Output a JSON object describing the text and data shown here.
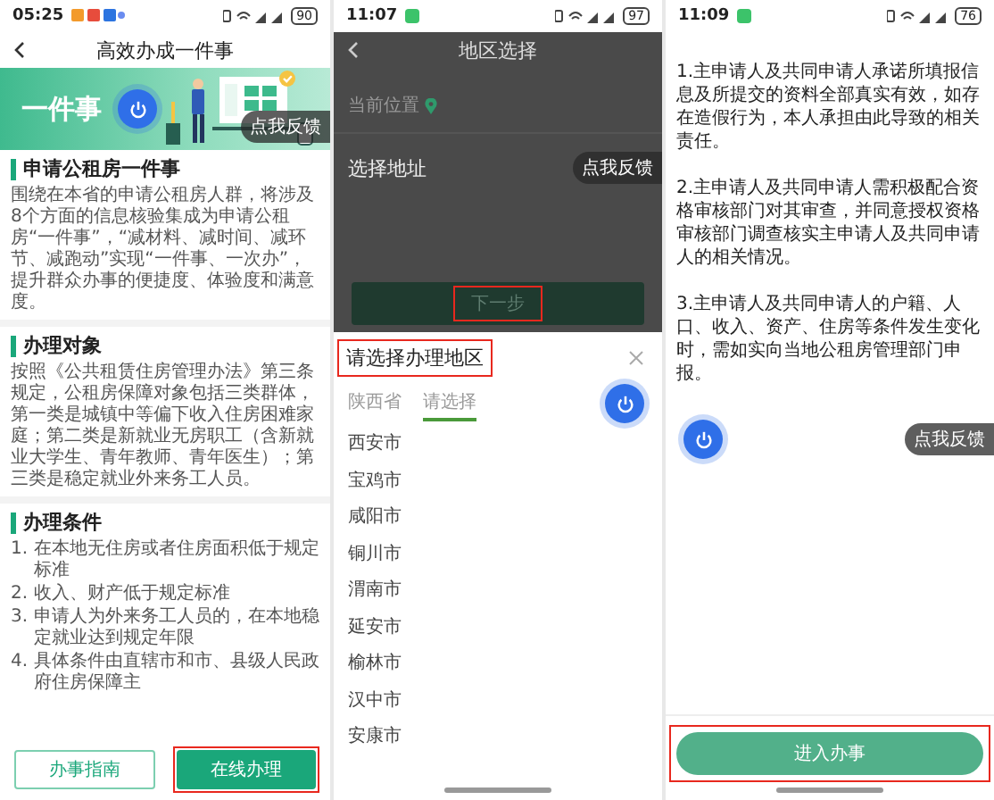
{
  "overview": {
    "status_bar": {
      "time": "05:25",
      "battery": "90"
    },
    "title": "高效办成一件事",
    "banner_text": "一件事",
    "feedback_label": "点我反馈",
    "sections": [
      {
        "heading": "申请公租房一件事",
        "kind": "paragraph",
        "text": "围绕在本省的申请公租房人群，将涉及8个方面的信息核验集成为申请公租房“一件事”，“减材料、减时间、减环节、减跑动”实现“一件事、一次办”，提升群众办事的便捷度、体验度和满意度。"
      },
      {
        "heading": "办理对象",
        "kind": "paragraph",
        "text": "按照《公共租赁住房管理办法》第三条规定，公租房保障对象包括三类群体，第一类是城镇中等偏下收入住房困难家庭；第二类是新就业无房职工（含新就业大学生、青年教师、青年医生）；第三类是稳定就业外来务工人员。"
      },
      {
        "heading": "办理条件",
        "kind": "list",
        "items": [
          {
            "number": "1.",
            "text": "在本地无住房或者住房面积低于规定标准"
          },
          {
            "number": "2.",
            "text": "收入、财产低于规定标准"
          },
          {
            "number": "3.",
            "text": "申请人为外来务工人员的，在本地稳定就业达到规定年限"
          },
          {
            "number": "4.",
            "text": "具体条件由直辖市和市、县级人民政府住房保障主"
          }
        ]
      }
    ],
    "buttons": [
      {
        "label": "办事指南",
        "kind": "outline",
        "highlighted": false
      },
      {
        "label": "在线办理",
        "kind": "primary",
        "highlighted": true
      }
    ]
  },
  "region_select": {
    "status_bar": {
      "time": "11:07",
      "battery": "97"
    },
    "page_title": "地区选择",
    "location_label": "当前位置",
    "address_label": "选择地址",
    "feedback_label": "点我反馈",
    "next_button": {
      "label": "下一步",
      "highlighted": true
    },
    "sheet": {
      "title": "请选择办理地区",
      "title_highlighted": true,
      "tabs": [
        {
          "label": "陕西省",
          "selected": false
        },
        {
          "label": "请选择",
          "selected": true
        }
      ],
      "cities": [
        "西安市",
        "宝鸡市",
        "咸阳市",
        "铜川市",
        "渭南市",
        "延安市",
        "榆林市",
        "汉中市",
        "安康市"
      ]
    }
  },
  "consent": {
    "status_bar": {
      "time": "11:09",
      "battery": "76"
    },
    "feedback_label": "点我反馈",
    "paragraphs": [
      "1.主申请人及共同申请人承诺所填报信息及所提交的资料全部真实有效，如存在造假行为，本人承担由此导致的相关责任。",
      "2.主申请人及共同申请人需积极配合资格审核部门对其审查，并同意授权资格审核部门调查核实主申请人及共同申请人的相关情况。",
      "3.主申请人及共同申请人的户籍、人口、收入、资产、住房等条件发生变化时，需如实向当地公租房管理部门申报。"
    ],
    "button": {
      "label": "进入办事",
      "highlighted": true
    }
  }
}
